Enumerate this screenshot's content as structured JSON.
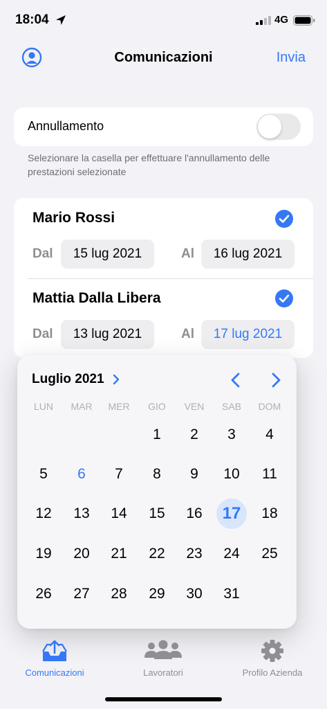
{
  "status_bar": {
    "time": "18:04",
    "network": "4G"
  },
  "nav": {
    "title": "Comunicazioni",
    "send_label": "Invia"
  },
  "cancel": {
    "label": "Annullamento",
    "enabled": false,
    "help": "Selezionare la casella per effettuare l'annullamento delle prestazioni selezionate"
  },
  "workers": [
    {
      "name": "Mario Rossi",
      "checked": true,
      "from_label": "Dal",
      "from": "15 lug 2021",
      "to_label": "Al",
      "to": "16 lug 2021"
    },
    {
      "name": "Mattia Dalla Libera",
      "checked": true,
      "from_label": "Dal",
      "from": "13 lug 2021",
      "to_label": "Al",
      "to": "17 lug 2021"
    }
  ],
  "calendar": {
    "month": "Luglio 2021",
    "weekdays": [
      "LUN",
      "MAR",
      "MER",
      "GIO",
      "VEN",
      "SAB",
      "DOM"
    ],
    "first_weekday_index": 3,
    "days_in_month": 31,
    "today": 6,
    "selected": 17
  },
  "tabs": [
    {
      "label": "Comunicazioni",
      "icon": "tray-upload-icon",
      "active": true
    },
    {
      "label": "Lavoratori",
      "icon": "people-icon",
      "active": false
    },
    {
      "label": "Profilo Azienda",
      "icon": "gear-icon",
      "active": false
    }
  ],
  "colors": {
    "accent": "#3478f6",
    "background": "#f2f2f7",
    "selected_day_bg": "#d8e6fb"
  }
}
